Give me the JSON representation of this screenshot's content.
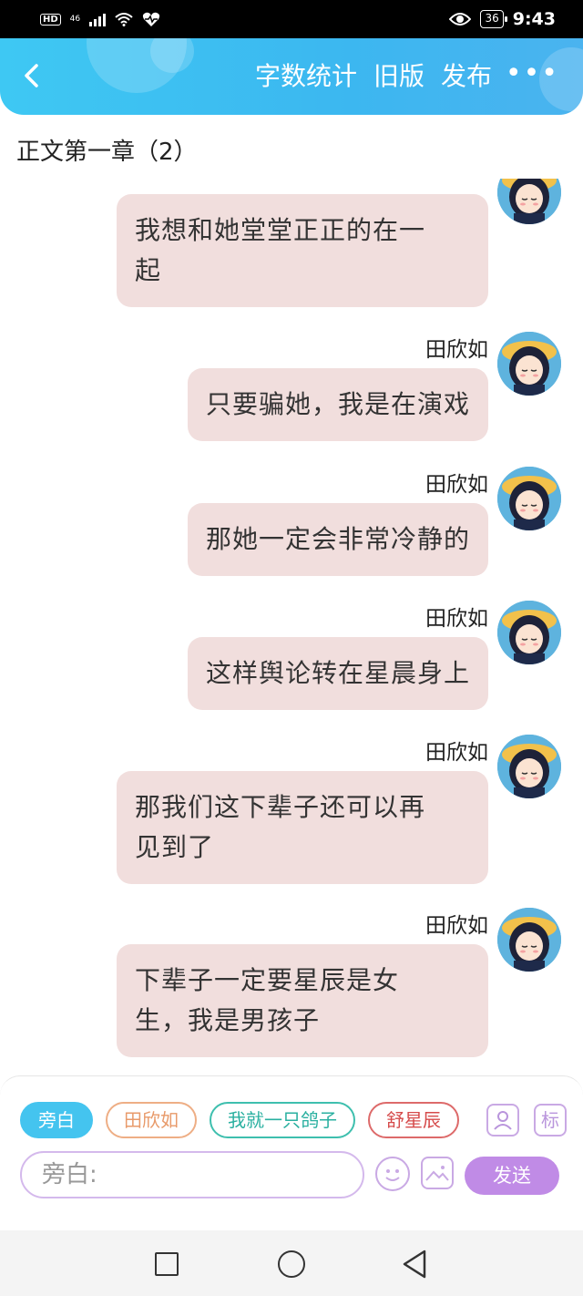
{
  "status_bar": {
    "hd": "HD",
    "network": "46",
    "battery": "36",
    "time": "9:43"
  },
  "header": {
    "actions": [
      "字数统计",
      "旧版",
      "发布"
    ],
    "more": "•••"
  },
  "chapter_title": "正文第一章（2）",
  "messages": [
    {
      "name": "",
      "text_lines": [
        "我想和她堂堂正正的在一",
        "起"
      ]
    },
    {
      "name": "田欣如",
      "text_lines": [
        "只要骗她，我是在演戏"
      ]
    },
    {
      "name": "田欣如",
      "text_lines": [
        "那她一定会非常冷静的"
      ]
    },
    {
      "name": "田欣如",
      "text_lines": [
        "这样舆论转在星晨身上"
      ]
    },
    {
      "name": "田欣如",
      "text_lines": [
        "那我们这下辈子还可以再",
        "见到了"
      ]
    },
    {
      "name": "田欣如",
      "text_lines": [
        "下辈子一定要星辰是女",
        "生，我是男孩子"
      ]
    }
  ],
  "roles": [
    "旁白",
    "田欣如",
    "我就一只鸽子",
    "舒星辰"
  ],
  "tool_label_biao": "标",
  "input": {
    "value": "旁白:"
  },
  "send_label": "发送",
  "colors": {
    "header": "#3cb7f0",
    "bubble": "#f1dedd",
    "accent": "#c08be6",
    "active_role": "#44c4ef"
  }
}
